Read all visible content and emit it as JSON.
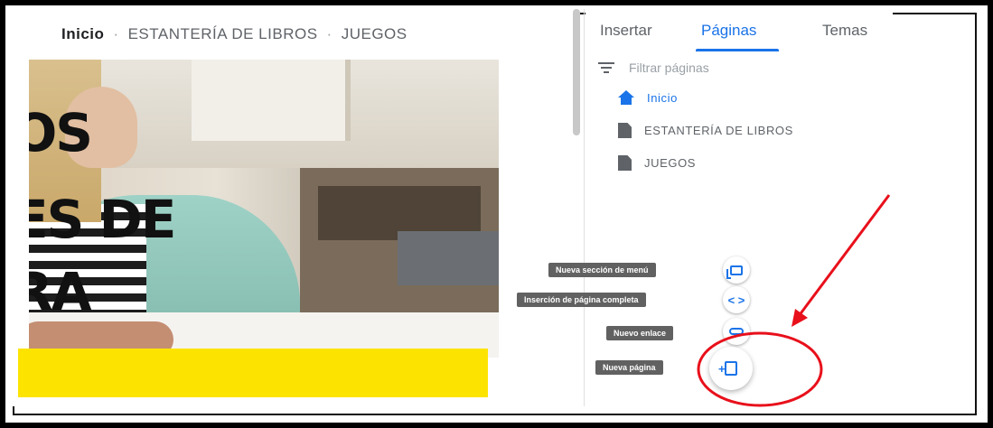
{
  "site": {
    "nav": {
      "home": "Inicio",
      "sep": "·",
      "shelf": "ESTANTERÍA DE LIBROS",
      "games": "JUEGOS"
    },
    "hero_text": {
      "line1": "OS",
      "line2": "ES DE",
      "line3": "RA"
    },
    "accent_yellow": "#fde400"
  },
  "panel": {
    "tabs": [
      {
        "label": "Insertar"
      },
      {
        "label": "Páginas"
      },
      {
        "label": "Temas"
      }
    ],
    "active_tab": "Páginas",
    "filter": {
      "placeholder": "Filtrar páginas",
      "value": ""
    },
    "pages": [
      {
        "label": "Inicio",
        "icon": "home-icon"
      },
      {
        "label": "ESTANTERÍA DE LIBROS",
        "icon": "page-icon"
      },
      {
        "label": "JUEGOS",
        "icon": "page-icon"
      }
    ],
    "accent": "#1a73e8"
  },
  "speed_dial": {
    "menu_section": "Nueva sección de menú",
    "full_page_embed": "Inserción de página completa",
    "new_link": "Nuevo enlace",
    "new_page": "Nueva página",
    "embed_symbol": "< >"
  },
  "annotation": {
    "color": "#e8101b"
  }
}
